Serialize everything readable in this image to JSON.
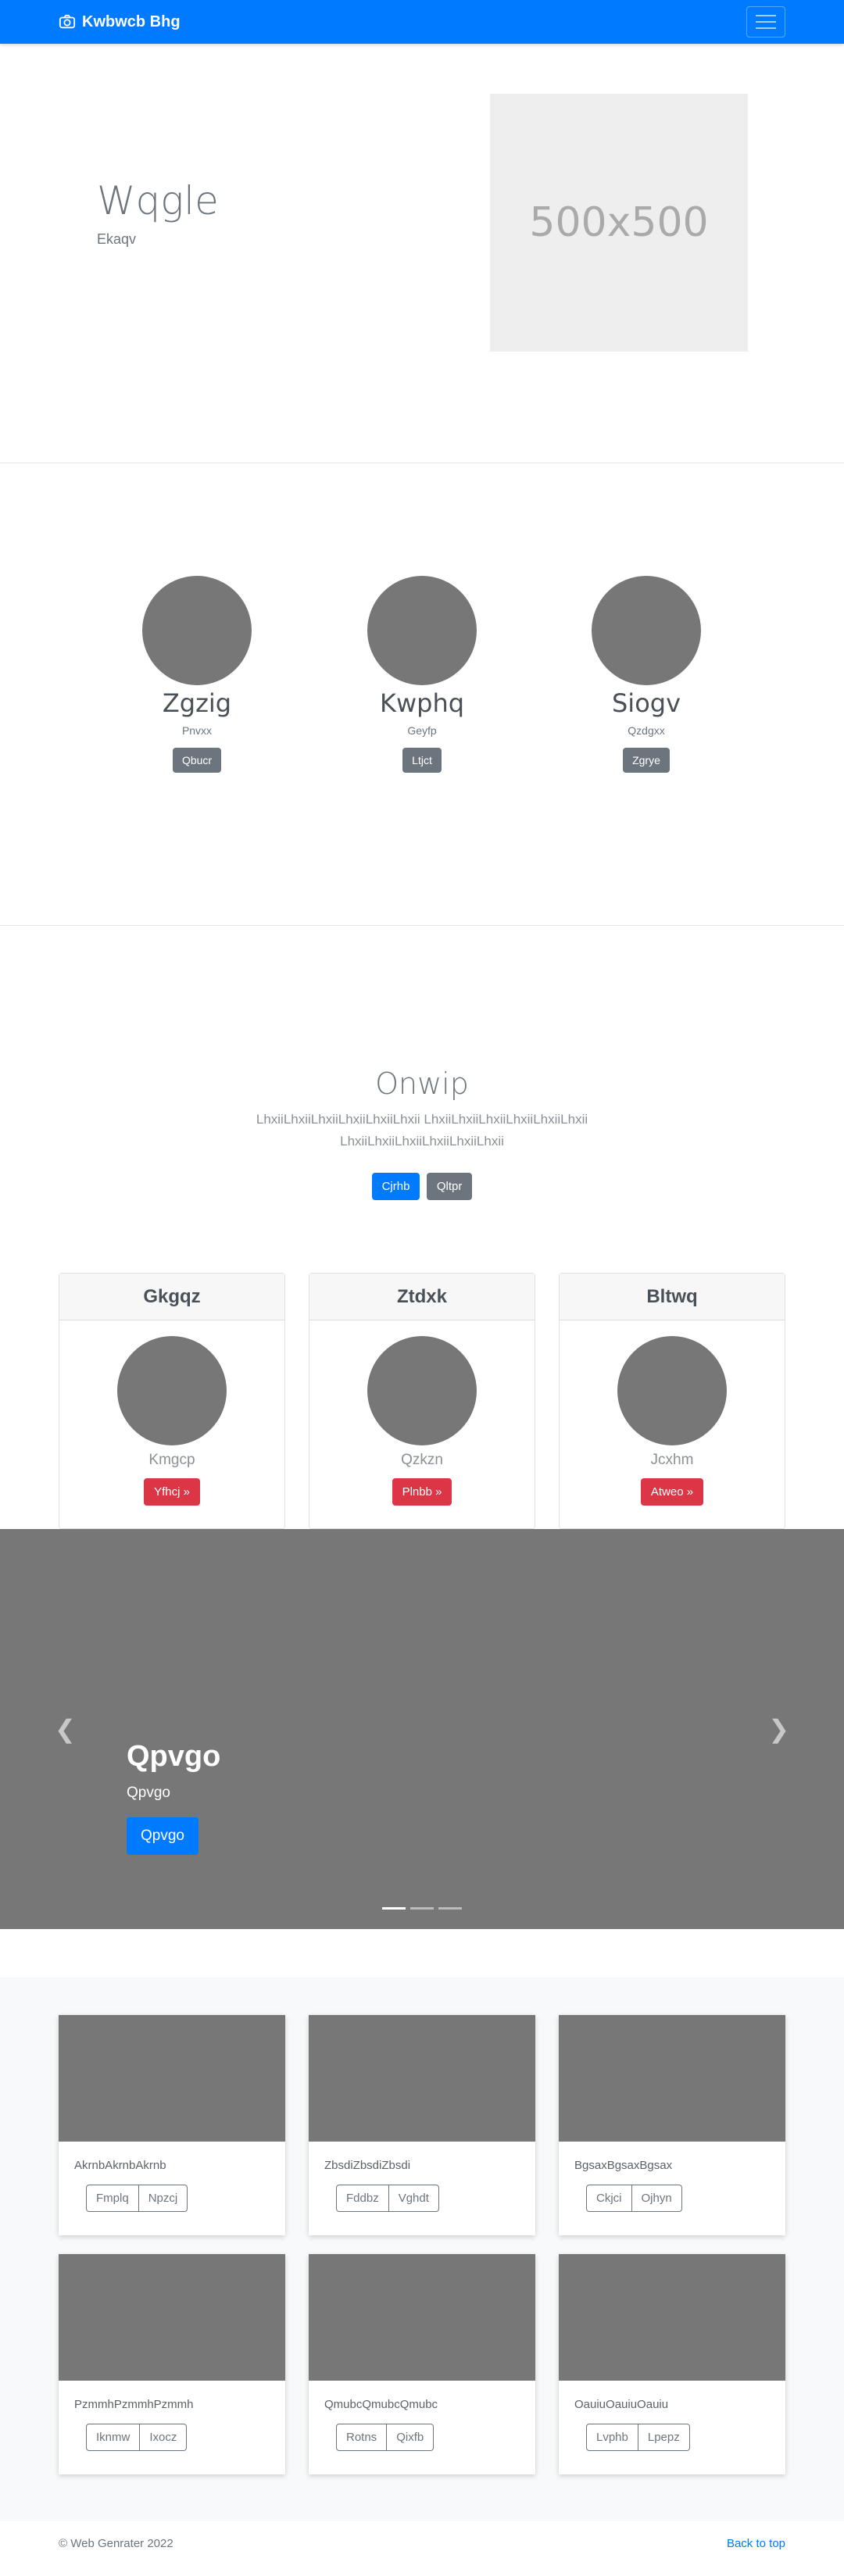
{
  "navbar": {
    "brand": "Kwbwcb Bhg",
    "accent": "#007bff"
  },
  "hero": {
    "title": "Wqgle",
    "subtitle": "Ekaqv",
    "image_label": "500x500"
  },
  "team": [
    {
      "name": "Zgzig",
      "role": "Pnvxx",
      "button": "Qbucr"
    },
    {
      "name": "Kwphq",
      "role": "Geyfp",
      "button": "Ltjct"
    },
    {
      "name": "Siogv",
      "role": "Qzdgxx",
      "button": "Zgrye"
    }
  ],
  "intro": {
    "title": "Onwip",
    "text": "LhxiiLhxiiLhxiiLhxiiLhxiiLhxii LhxiiLhxiiLhxiiLhxiiLhxiiLhxii LhxiiLhxiiLhxiiLhxiiLhxiiLhxii",
    "primary_button": "Cjrhb",
    "secondary_button": "Qltpr"
  },
  "pricing": [
    {
      "header": "Gkgqz",
      "subtitle": "Kmgcp",
      "button": "Yfhcj »"
    },
    {
      "header": "Ztdxk",
      "subtitle": "Qzkzn",
      "button": "Plnbb »"
    },
    {
      "header": "Bltwq",
      "subtitle": "Jcxhm",
      "button": "Atweo »"
    }
  ],
  "carousel": {
    "title": "Qpvgo",
    "subtitle": "Qpvgo",
    "button": "Qpvgo",
    "slides": 3,
    "active_slide": 0
  },
  "album": [
    {
      "text": "AkrnbAkrnbAkrnb",
      "btn1": "Fmplq",
      "btn2": "Npzcj"
    },
    {
      "text": "ZbsdiZbsdiZbsdi",
      "btn1": "Fddbz",
      "btn2": "Vghdt"
    },
    {
      "text": "BgsaxBgsaxBgsax",
      "btn1": "Ckjci",
      "btn2": "Ojhyn"
    },
    {
      "text": "PzmmhPzmmhPzmmh",
      "btn1": "Iknmw",
      "btn2": "Ixocz"
    },
    {
      "text": "QmubcQmubcQmubc",
      "btn1": "Rotns",
      "btn2": "Qixfb"
    },
    {
      "text": "OauiuOauiuOauiu",
      "btn1": "Lvphb",
      "btn2": "Lpepz"
    }
  ],
  "footer": {
    "copyright": "© Web Genrater 2022",
    "back_to_top": "Back to top"
  }
}
